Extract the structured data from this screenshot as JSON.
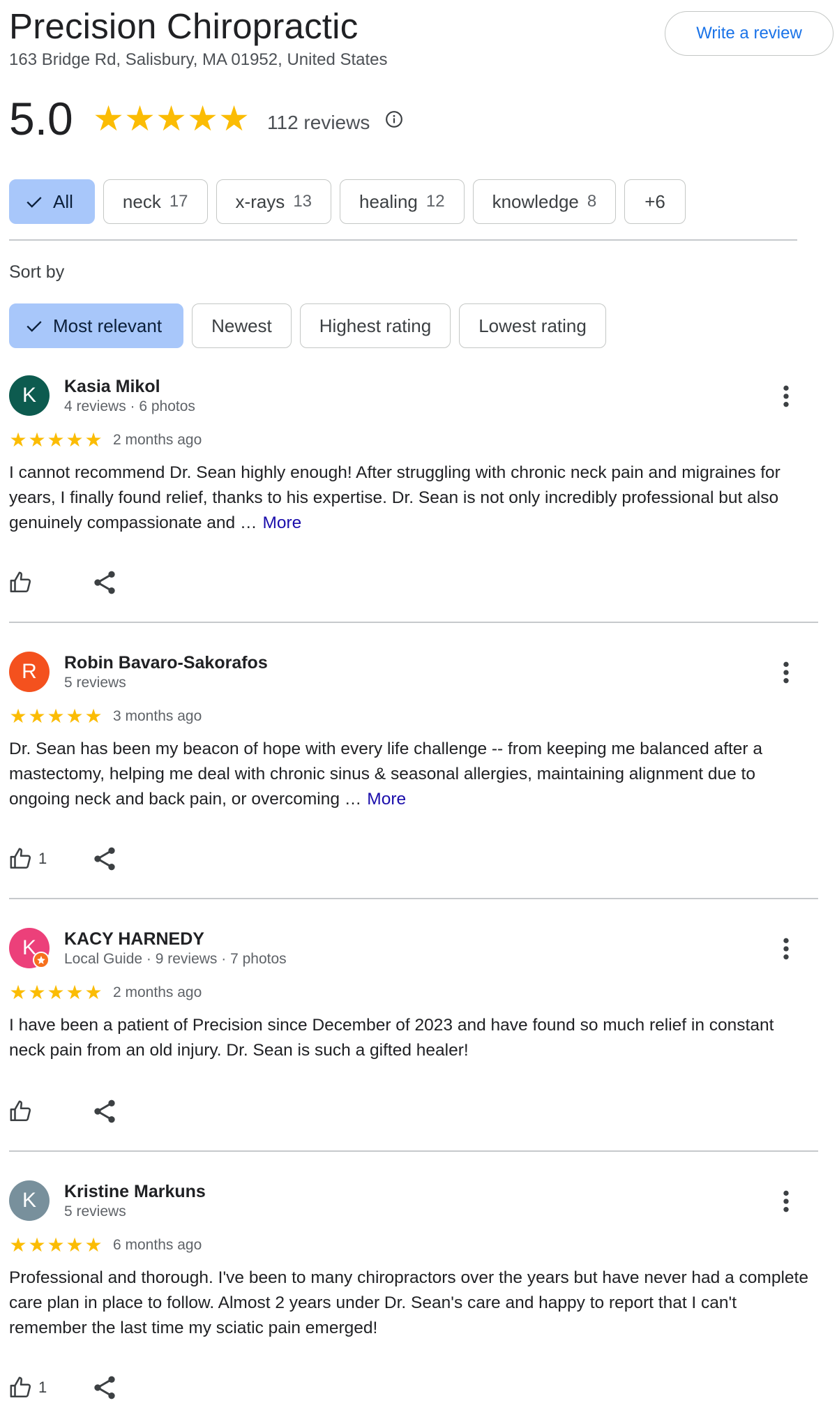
{
  "business": {
    "name": "Precision Chiropractic",
    "address": "163 Bridge Rd, Salisbury, MA 01952, United States",
    "write_review_label": "Write a review",
    "rating": "5.0",
    "rating_stars": 5,
    "review_count_label": "112 reviews"
  },
  "topics": [
    {
      "label": "All",
      "count": "",
      "selected": true
    },
    {
      "label": "neck",
      "count": "17",
      "selected": false
    },
    {
      "label": "x-rays",
      "count": "13",
      "selected": false
    },
    {
      "label": "healing",
      "count": "12",
      "selected": false
    },
    {
      "label": "knowledge",
      "count": "8",
      "selected": false
    },
    {
      "label": "+6",
      "count": "",
      "selected": false
    }
  ],
  "sort": {
    "label": "Sort by",
    "options": [
      {
        "label": "Most relevant",
        "selected": true
      },
      {
        "label": "Newest",
        "selected": false
      },
      {
        "label": "Highest rating",
        "selected": false
      },
      {
        "label": "Lowest rating",
        "selected": false
      }
    ]
  },
  "reviews": [
    {
      "initial": "K",
      "avatar_color": "#0d5b4f",
      "local_guide": false,
      "name": "Kasia Mikol",
      "meta": "4 reviews · 6 photos",
      "stars": 5,
      "time": "2 months ago",
      "text": "I cannot recommend Dr. Sean highly enough! After struggling with chronic neck pain and migraines for years, I finally found relief, thanks to his expertise. Dr. Sean is not only incredibly professional but also genuinely compassionate and …",
      "more_label": "More",
      "likes": ""
    },
    {
      "initial": "R",
      "avatar_color": "#f4511e",
      "local_guide": false,
      "name": "Robin Bavaro-Sakorafos",
      "meta": "5 reviews",
      "stars": 5,
      "time": "3 months ago",
      "text": "Dr. Sean has been my beacon of hope with every life challenge -- from keeping me balanced after a mastectomy, helping me deal with chronic sinus & seasonal allergies, maintaining alignment due to ongoing neck and back pain, or overcoming …",
      "more_label": "More",
      "likes": "1"
    },
    {
      "initial": "K",
      "avatar_color": "#ec407a",
      "local_guide": true,
      "name": "KACY HARNEDY",
      "meta": "Local Guide · 9 reviews · 7 photos",
      "stars": 5,
      "time": "2 months ago",
      "text": "I have been a patient of Precision since December of 2023 and have found so much relief in constant neck pain from an old injury. Dr. Sean is such a gifted healer!",
      "more_label": "",
      "likes": ""
    },
    {
      "initial": "K",
      "avatar_color": "#78909c",
      "local_guide": false,
      "name": "Kristine Markuns",
      "meta": "5 reviews",
      "stars": 5,
      "time": "6 months ago",
      "text": "Professional and thorough. I've been to many chiropractors over the years but have never had a complete care plan in place to follow. Almost 2 years under Dr. Sean's care and happy to report that I can't remember the last time my sciatic pain emerged!",
      "more_label": "",
      "likes": "1"
    }
  ]
}
